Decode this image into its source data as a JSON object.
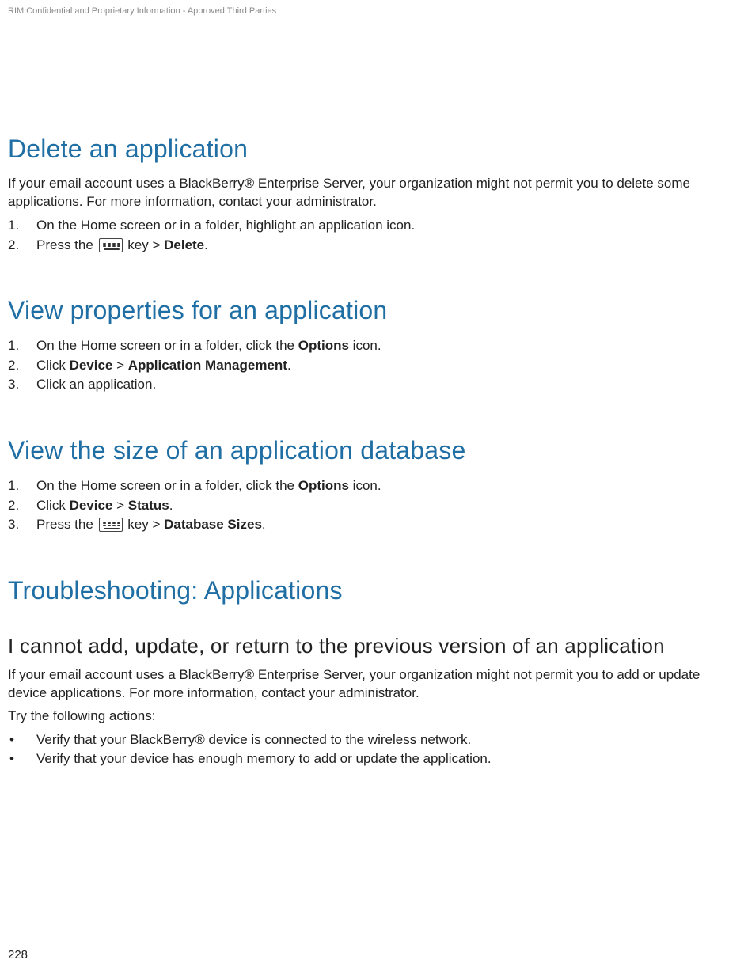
{
  "header": {
    "confidential": "RIM Confidential and Proprietary Information - Approved Third Parties"
  },
  "sections": {
    "delete": {
      "title": "Delete an application",
      "intro": "If your email account uses a BlackBerry® Enterprise Server, your organization might not permit you to delete some applications. For more information, contact your administrator.",
      "step1": "On the Home screen or in a folder, highlight an application icon.",
      "step2_pre": "Press the ",
      "step2_post": " key > ",
      "step2_bold": "Delete",
      "step2_end": "."
    },
    "viewprops": {
      "title": "View properties for an application",
      "step1_pre": "On the Home screen or in a folder, click the ",
      "step1_bold": "Options",
      "step1_post": " icon.",
      "step2_pre": "Click ",
      "step2_b1": "Device",
      "step2_mid": " > ",
      "step2_b2": "Application Management",
      "step2_post": ".",
      "step3": "Click an application."
    },
    "viewsize": {
      "title": "View the size of an application database",
      "step1_pre": "On the Home screen or in a folder, click the ",
      "step1_bold": "Options",
      "step1_post": " icon.",
      "step2_pre": "Click ",
      "step2_b1": "Device",
      "step2_mid": " > ",
      "step2_b2": "Status",
      "step2_post": ".",
      "step3_pre": "Press the ",
      "step3_post": " key > ",
      "step3_bold": "Database Sizes",
      "step3_end": "."
    },
    "trouble": {
      "title": "Troubleshooting: Applications",
      "sub": "I cannot add, update, or return to the previous version of an application",
      "p1": "If your email account uses a BlackBerry® Enterprise Server, your organization might not permit you to add or update device applications. For more information, contact your administrator.",
      "p2": "Try the following actions:",
      "b1": "Verify that your BlackBerry® device is connected to the wireless network.",
      "b2": "Verify that your device has enough memory to add or update the application."
    }
  },
  "footer": {
    "page": "228"
  }
}
